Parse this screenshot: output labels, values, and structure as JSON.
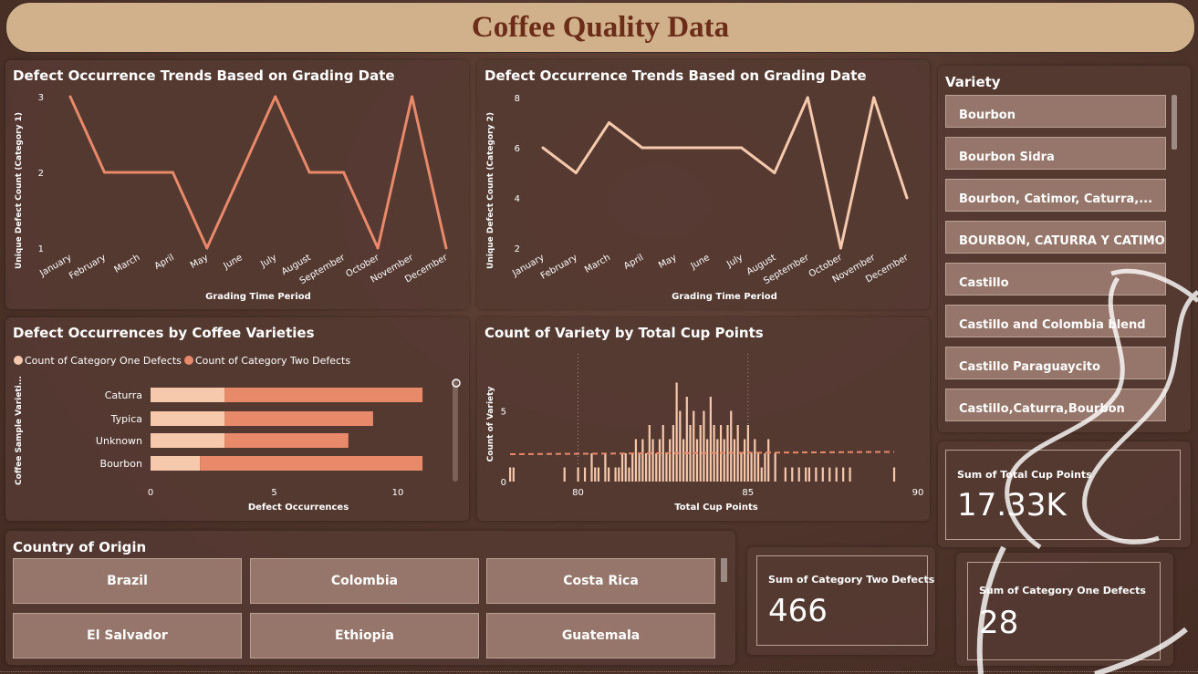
{
  "title": "Coffee Quality Data",
  "colors": {
    "cat1": "#f6c9ad",
    "cat2": "#e8896a",
    "line1": "#e8896a",
    "line2": "#f6c9ad",
    "banner": "#d1b08c"
  },
  "line_chart_1": {
    "title": "Defect Occurrence Trends Based on Grading Date",
    "xlabel": "Grading Time Period",
    "ylabel": "Unique Defect Count (Category 1)",
    "yticks": [
      "1",
      "2",
      "3"
    ],
    "months": [
      "January",
      "February",
      "March",
      "April",
      "May",
      "June",
      "July",
      "August",
      "September",
      "October",
      "November",
      "December"
    ]
  },
  "line_chart_2": {
    "title": "Defect Occurrence Trends Based on Grading Date",
    "xlabel": "Grading Time Period",
    "ylabel": "Unique Defect Count (Category 2)",
    "yticks": [
      "2",
      "4",
      "6",
      "8"
    ],
    "months": [
      "January",
      "February",
      "March",
      "April",
      "May",
      "June",
      "July",
      "August",
      "September",
      "October",
      "November",
      "December"
    ]
  },
  "bar_chart": {
    "title": "Defect Occurrences by Coffee Varieties",
    "legend": [
      "Count of Category One Defects",
      "Count of Category Two Defects"
    ],
    "ylabel": "Coffee Sample Varieti...",
    "xlabel": "Defect Occurrences",
    "xticks": [
      "0",
      "5",
      "10"
    ]
  },
  "histogram": {
    "title": "Count of Variety by Total Cup Points",
    "ylabel": "Count of Variety",
    "xlabel": "Total Cup Points",
    "yticks": [
      "0",
      "5"
    ],
    "xticks": [
      "80",
      "85",
      "90"
    ]
  },
  "chart_data": [
    {
      "type": "line",
      "x": [
        "January",
        "February",
        "March",
        "April",
        "May",
        "June",
        "July",
        "August",
        "September",
        "October",
        "November",
        "December"
      ],
      "series": [
        {
          "values": [
            3,
            2,
            2,
            2,
            1,
            2,
            3,
            2,
            2,
            1,
            3,
            1
          ]
        }
      ],
      "title": "Defect Occurrence Trends Based on Grading Date",
      "xlabel": "Grading Time Period",
      "ylabel": "Unique Defect Count (Category 1)",
      "ylim": [
        1,
        3
      ]
    },
    {
      "type": "line",
      "x": [
        "January",
        "February",
        "March",
        "April",
        "May",
        "June",
        "July",
        "August",
        "September",
        "October",
        "November",
        "December"
      ],
      "series": [
        {
          "values": [
            6,
            5,
            7,
            6,
            6,
            6,
            6,
            5,
            8,
            2,
            8,
            4
          ]
        }
      ],
      "title": "Defect Occurrence Trends Based on Grading Date",
      "xlabel": "Grading Time Period",
      "ylabel": "Unique Defect Count (Category 2)",
      "ylim": [
        2,
        8
      ]
    },
    {
      "type": "bar",
      "orientation": "horizontal",
      "stacked": true,
      "categories": [
        "Caturra",
        "Typica",
        "Unknown",
        "Bourbon"
      ],
      "series": [
        {
          "name": "Count of Category One Defects",
          "values": [
            3,
            3,
            3,
            2
          ]
        },
        {
          "name": "Count of Category Two Defects",
          "values": [
            8,
            6,
            5,
            9
          ]
        }
      ],
      "title": "Defect Occurrences by Coffee Varieties",
      "xlabel": "Defect Occurrences",
      "ylabel": "Coffee Sample Varieti...",
      "xlim": [
        0,
        11
      ]
    },
    {
      "type": "bar",
      "x": [
        78.0,
        78.1,
        79.6,
        80.0,
        80.2,
        80.4,
        80.5,
        80.6,
        80.8,
        80.9,
        81.1,
        81.2,
        81.3,
        81.4,
        81.5,
        81.6,
        81.7,
        81.8,
        81.9,
        82.0,
        82.1,
        82.2,
        82.3,
        82.4,
        82.5,
        82.6,
        82.7,
        82.8,
        82.9,
        83.0,
        83.1,
        83.2,
        83.3,
        83.4,
        83.5,
        83.6,
        83.7,
        83.8,
        83.9,
        84.0,
        84.1,
        84.2,
        84.3,
        84.4,
        84.5,
        84.6,
        84.7,
        84.8,
        84.9,
        85.0,
        85.1,
        85.2,
        85.3,
        85.4,
        85.5,
        85.6,
        85.8,
        86.1,
        86.3,
        86.5,
        86.7,
        86.8,
        87.0,
        87.2,
        87.4,
        87.6,
        87.8,
        88.0,
        89.3
      ],
      "values": [
        1,
        1,
        1,
        1,
        1,
        2,
        1,
        1,
        2,
        1,
        1,
        1,
        2,
        2,
        1,
        2,
        3,
        2,
        3,
        2,
        4,
        3,
        2,
        3,
        4,
        2,
        3,
        4,
        7,
        5,
        3,
        6,
        4,
        5,
        3,
        4,
        5,
        3,
        6,
        4,
        3,
        4,
        3,
        4,
        5,
        3,
        4,
        2,
        3,
        4,
        2,
        3,
        2,
        1,
        2,
        3,
        2,
        1,
        1,
        1,
        1,
        1,
        1,
        1,
        1,
        1,
        1,
        1,
        1
      ],
      "trend_value": 2.0,
      "title": "Count of Variety by Total Cup Points",
      "xlabel": "Total Cup Points",
      "ylabel": "Count of Variety",
      "xlim": [
        78,
        90
      ],
      "ylim": [
        0,
        8
      ]
    }
  ],
  "variety_slicer": {
    "title": "Variety",
    "items": [
      "Bourbon",
      "Bourbon Sidra",
      "Bourbon, Catimor, Caturra,...",
      "BOURBON, CATURRA Y CATIMOR",
      "Castillo",
      "Castillo and Colombia blend",
      "Castillo Paraguaycito",
      "Castillo,Caturra,Bourbon"
    ]
  },
  "country_slicer": {
    "title": "Country of Origin",
    "items": [
      "Brazil",
      "Colombia",
      "Costa Rica",
      "El Salvador",
      "Ethiopia",
      "Guatemala"
    ]
  },
  "cards": {
    "total_cup_points": {
      "label": "Sum of Total Cup Points",
      "value": "17.33K"
    },
    "cat_two": {
      "label": "Sum of Category Two Defects",
      "value": "466"
    },
    "cat_one": {
      "label": "Sum of Category One Defects",
      "value": "28"
    }
  }
}
